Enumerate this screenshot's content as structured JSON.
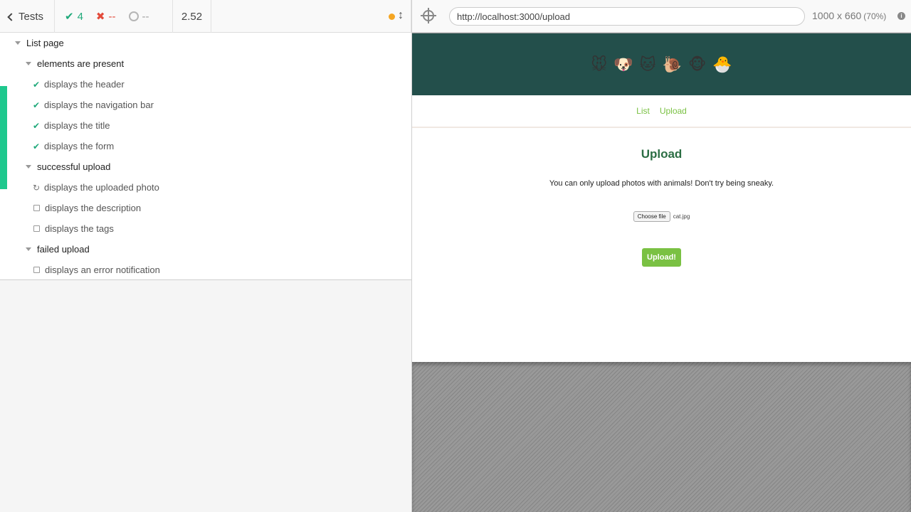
{
  "header": {
    "tests_label": "Tests",
    "passed": "4",
    "failed": "--",
    "pending": "--",
    "duration": "2.52"
  },
  "tree": {
    "root": "List page",
    "suite1": "elements are present",
    "t1": "displays the header",
    "t2": "displays the navigation bar",
    "t3": "displays the title",
    "t4": "displays the form",
    "suite2": "successful upload",
    "t5": "displays the uploaded photo",
    "t6": "displays the description",
    "t7": "displays the tags",
    "suite3": "failed upload",
    "t8": "displays an error notification"
  },
  "runner": {
    "url": "http://localhost:3000/upload",
    "viewport": "1000 x 660",
    "zoom": "(70%)"
  },
  "app": {
    "emojis": [
      "🐭",
      "🐶",
      "🐱",
      "🐌",
      "🐵",
      "🐣"
    ],
    "nav_list": "List",
    "nav_upload": "Upload",
    "title": "Upload",
    "description": "You can only upload photos with animals! Don't try being sneaky.",
    "choose_file": "Choose file",
    "file_name": "cat.jpg",
    "submit": "Upload!"
  },
  "colors": {
    "pass": "#1fa97a",
    "fail": "#e34b3b",
    "banner": "#234f4b",
    "accent": "#7ac143",
    "title": "#2c6e44"
  }
}
